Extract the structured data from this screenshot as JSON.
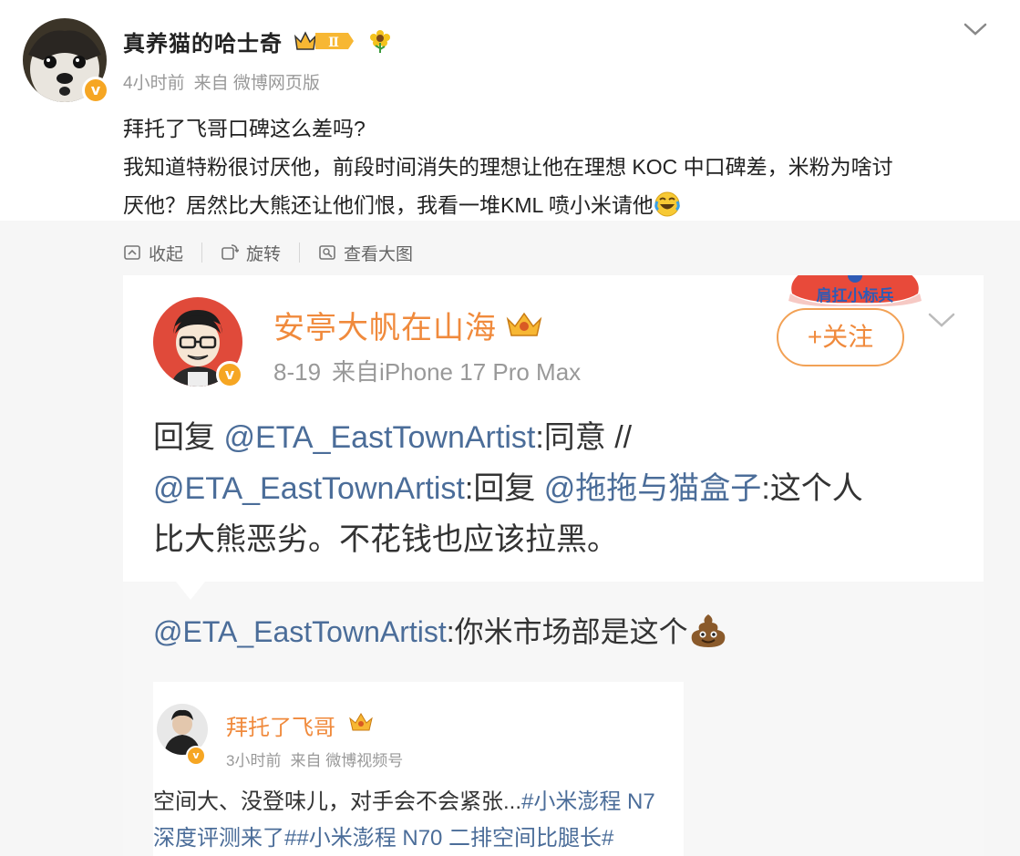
{
  "post": {
    "username": "真养猫的哈士奇",
    "level_badge": "Ⅱ",
    "time": "4小时前",
    "source": "来自 微博网页版",
    "text_lines": [
      "拜托了飞哥口碑这么差吗?",
      "我知道特粉很讨厌他，前段时间消失的理想让他在理想 KOC 中口碑差，米粉为啥讨",
      "厌他？居然比大熊还让他们恨，我看一堆KML 喷小米请他"
    ]
  },
  "toolbar": {
    "collapse": "收起",
    "rotate": "旋转",
    "view_large": "查看大图"
  },
  "screenshot": {
    "stamp_text": "肩扛小标兵",
    "username": "安亭大帆在山海",
    "date": "8-19",
    "source": "来自iPhone 17 Pro Max",
    "follow_label": "+关注",
    "reply": {
      "prefix1": "回复 ",
      "mention1": "@ETA_EastTownArtist",
      "text1": ":同意 //",
      "mention2": "@ETA_EastTownArtist",
      "text2": ":回复 ",
      "mention3": "@拖拖与猫盒子",
      "text3": ":这个人",
      "line3": "比大熊恶劣。不花钱也应该拉黑。"
    },
    "forward": {
      "mention": "@ETA_EastTownArtist",
      "text": ":你米市场部是这个"
    },
    "inner": {
      "username": "拜托了飞哥",
      "time": "3小时前",
      "source": "来自 微博视频号",
      "line1_plain": "空间大、没登味儿，对手会不会紧张...",
      "line1_tag": "#小米澎程 N7",
      "line2_tag": "深度评测来了##小米澎程 N70 二排空间比腿长#"
    }
  },
  "colors": {
    "accent_orange": "#f08a3c",
    "link_blue": "#4b6d99",
    "verified": "#f6a623"
  },
  "icons": [
    "verified-badge-icon",
    "level-badge-icon",
    "sunflower-icon",
    "chevron-down-icon",
    "collapse-icon",
    "rotate-icon",
    "view-large-icon",
    "crown-icon",
    "laugh-cry-emoji",
    "poop-emoji"
  ]
}
